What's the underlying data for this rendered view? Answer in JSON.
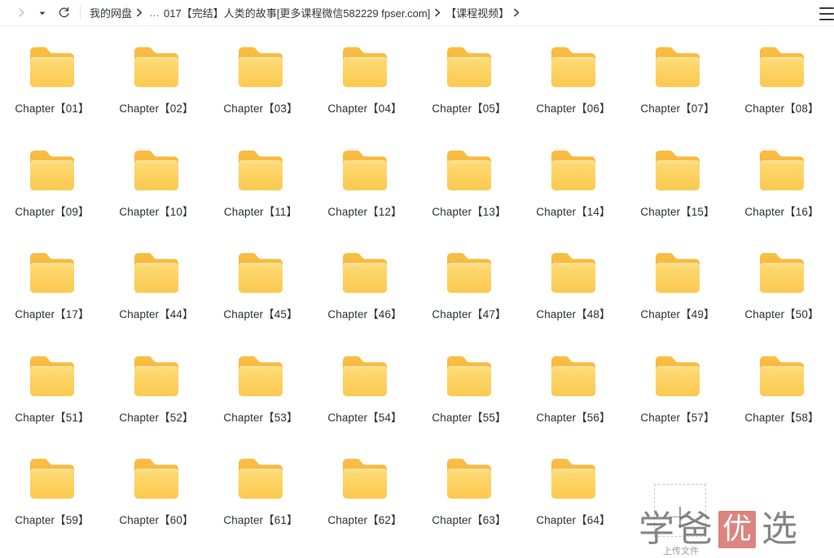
{
  "toolbar": {
    "forward_label": "前进",
    "history_dropdown_label": "历史记录",
    "refresh_label": "刷新",
    "menu_label": "菜单",
    "icons": {
      "forward": "chevron-right-icon",
      "dropdown": "chevron-down-icon",
      "refresh": "refresh-icon",
      "menu": "hamburger-menu-icon"
    }
  },
  "breadcrumb": {
    "root": "我的网盘",
    "ellipsis": "…",
    "items": [
      "017【完结】人类的故事[更多课程微信582229 fpser.com]",
      "【课程视频】"
    ],
    "separator": "＞"
  },
  "upload": {
    "label": "上传文件",
    "plus_icon": "plus-icon"
  },
  "watermark": {
    "chars": [
      "学",
      "爸",
      "优",
      "选"
    ],
    "seal_index": 2,
    "seal_color": "#d9736f",
    "text_color": "#6b6b6b"
  },
  "colors": {
    "folder_back": "#F7B93E",
    "folder_front": "#FDD366",
    "folder_front_top": "#FCE08C",
    "label_text": "#2e3238",
    "background": "#ffffff",
    "toolbar_border": "#ececec"
  },
  "files": [
    {
      "name": "Chapter【01】",
      "type": "folder"
    },
    {
      "name": "Chapter【02】",
      "type": "folder"
    },
    {
      "name": "Chapter【03】",
      "type": "folder"
    },
    {
      "name": "Chapter【04】",
      "type": "folder"
    },
    {
      "name": "Chapter【05】",
      "type": "folder"
    },
    {
      "name": "Chapter【06】",
      "type": "folder"
    },
    {
      "name": "Chapter【07】",
      "type": "folder"
    },
    {
      "name": "Chapter【08】",
      "type": "folder"
    },
    {
      "name": "Chapter【09】",
      "type": "folder"
    },
    {
      "name": "Chapter【10】",
      "type": "folder"
    },
    {
      "name": "Chapter【11】",
      "type": "folder"
    },
    {
      "name": "Chapter【12】",
      "type": "folder"
    },
    {
      "name": "Chapter【13】",
      "type": "folder"
    },
    {
      "name": "Chapter【14】",
      "type": "folder"
    },
    {
      "name": "Chapter【15】",
      "type": "folder"
    },
    {
      "name": "Chapter【16】",
      "type": "folder"
    },
    {
      "name": "Chapter【17】",
      "type": "folder"
    },
    {
      "name": "Chapter【44】",
      "type": "folder"
    },
    {
      "name": "Chapter【45】",
      "type": "folder"
    },
    {
      "name": "Chapter【46】",
      "type": "folder"
    },
    {
      "name": "Chapter【47】",
      "type": "folder"
    },
    {
      "name": "Chapter【48】",
      "type": "folder"
    },
    {
      "name": "Chapter【49】",
      "type": "folder"
    },
    {
      "name": "Chapter【50】",
      "type": "folder"
    },
    {
      "name": "Chapter【51】",
      "type": "folder"
    },
    {
      "name": "Chapter【52】",
      "type": "folder"
    },
    {
      "name": "Chapter【53】",
      "type": "folder"
    },
    {
      "name": "Chapter【54】",
      "type": "folder"
    },
    {
      "name": "Chapter【55】",
      "type": "folder"
    },
    {
      "name": "Chapter【56】",
      "type": "folder"
    },
    {
      "name": "Chapter【57】",
      "type": "folder"
    },
    {
      "name": "Chapter【58】",
      "type": "folder"
    },
    {
      "name": "Chapter【59】",
      "type": "folder"
    },
    {
      "name": "Chapter【60】",
      "type": "folder"
    },
    {
      "name": "Chapter【61】",
      "type": "folder"
    },
    {
      "name": "Chapter【62】",
      "type": "folder"
    },
    {
      "name": "Chapter【63】",
      "type": "folder"
    },
    {
      "name": "Chapter【64】",
      "type": "folder"
    }
  ]
}
